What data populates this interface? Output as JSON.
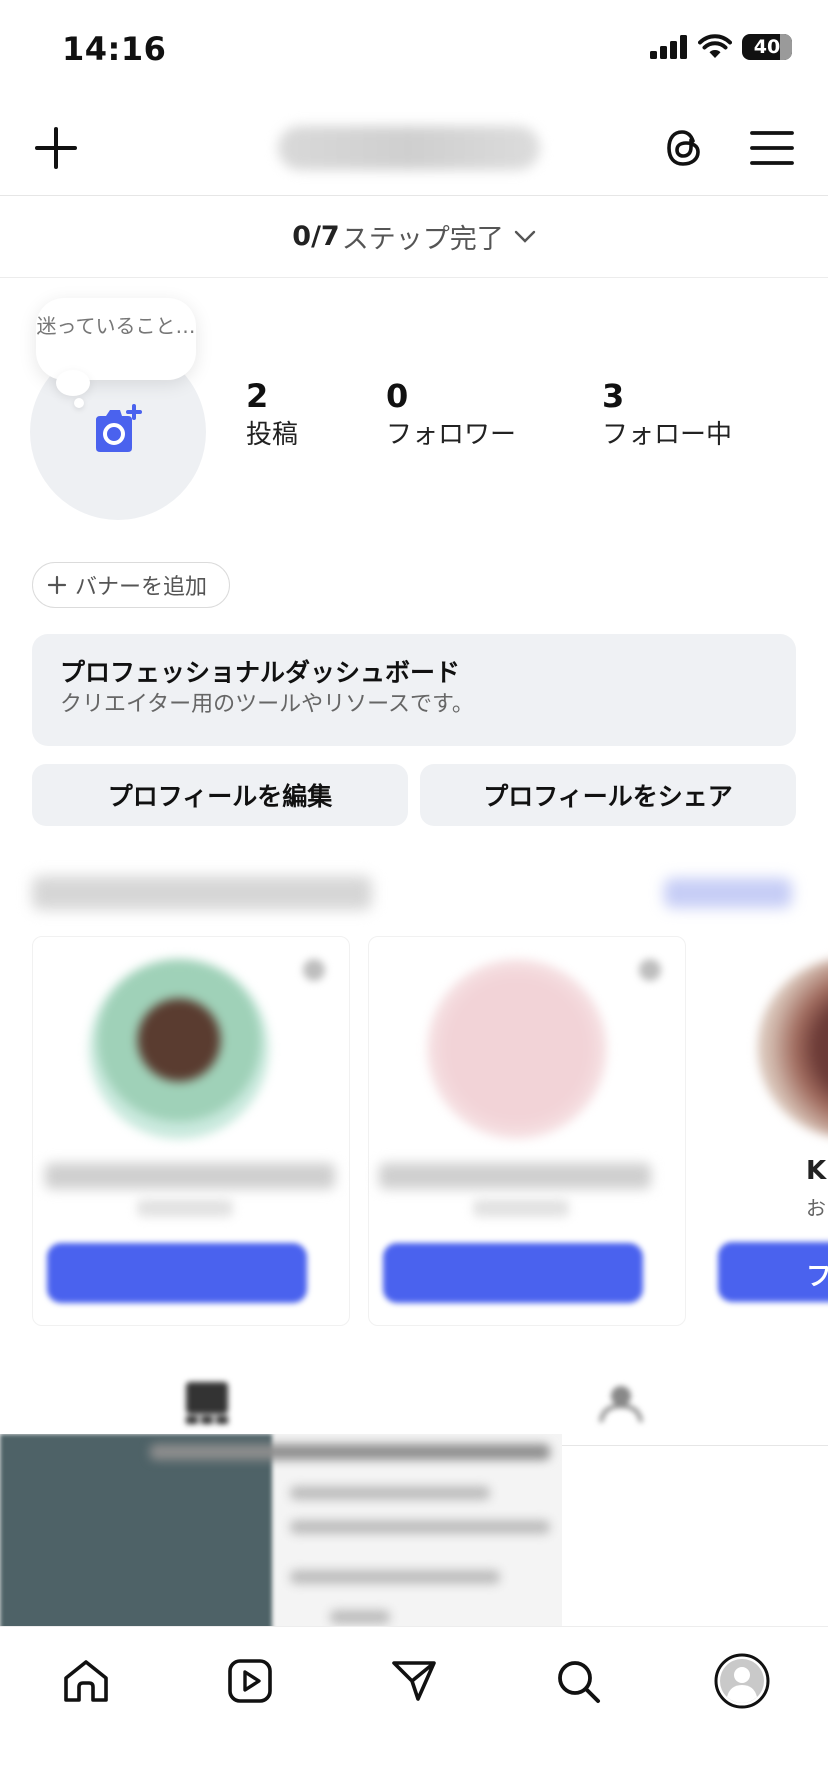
{
  "status_bar": {
    "time": "14:16",
    "battery": "40"
  },
  "header": {
    "icons": [
      "plus-icon",
      "threads-icon",
      "menu-icon"
    ]
  },
  "steps": {
    "count": "0/7",
    "label": "ステップ完了"
  },
  "profile": {
    "tooltip": "迷っていること…",
    "stats": [
      {
        "value": "2",
        "label": "投稿"
      },
      {
        "value": "0",
        "label": "フォロワー"
      },
      {
        "value": "3",
        "label": "フォロー中"
      }
    ]
  },
  "banner": {
    "label": "バナーを追加"
  },
  "dashboard": {
    "title": "プロフェッショナルダッシュボード",
    "subtitle": "クリエイター用のツールやリソースです。"
  },
  "actions": {
    "edit": "プロフィールを編集",
    "share": "プロフィールをシェア"
  },
  "suggestions": {
    "partial_name": "K",
    "partial_sub": "お",
    "partial_button": "フ"
  },
  "colors": {
    "accent": "#4a62ee",
    "background": "#ffffff",
    "muted_bg": "#eff1f4"
  }
}
